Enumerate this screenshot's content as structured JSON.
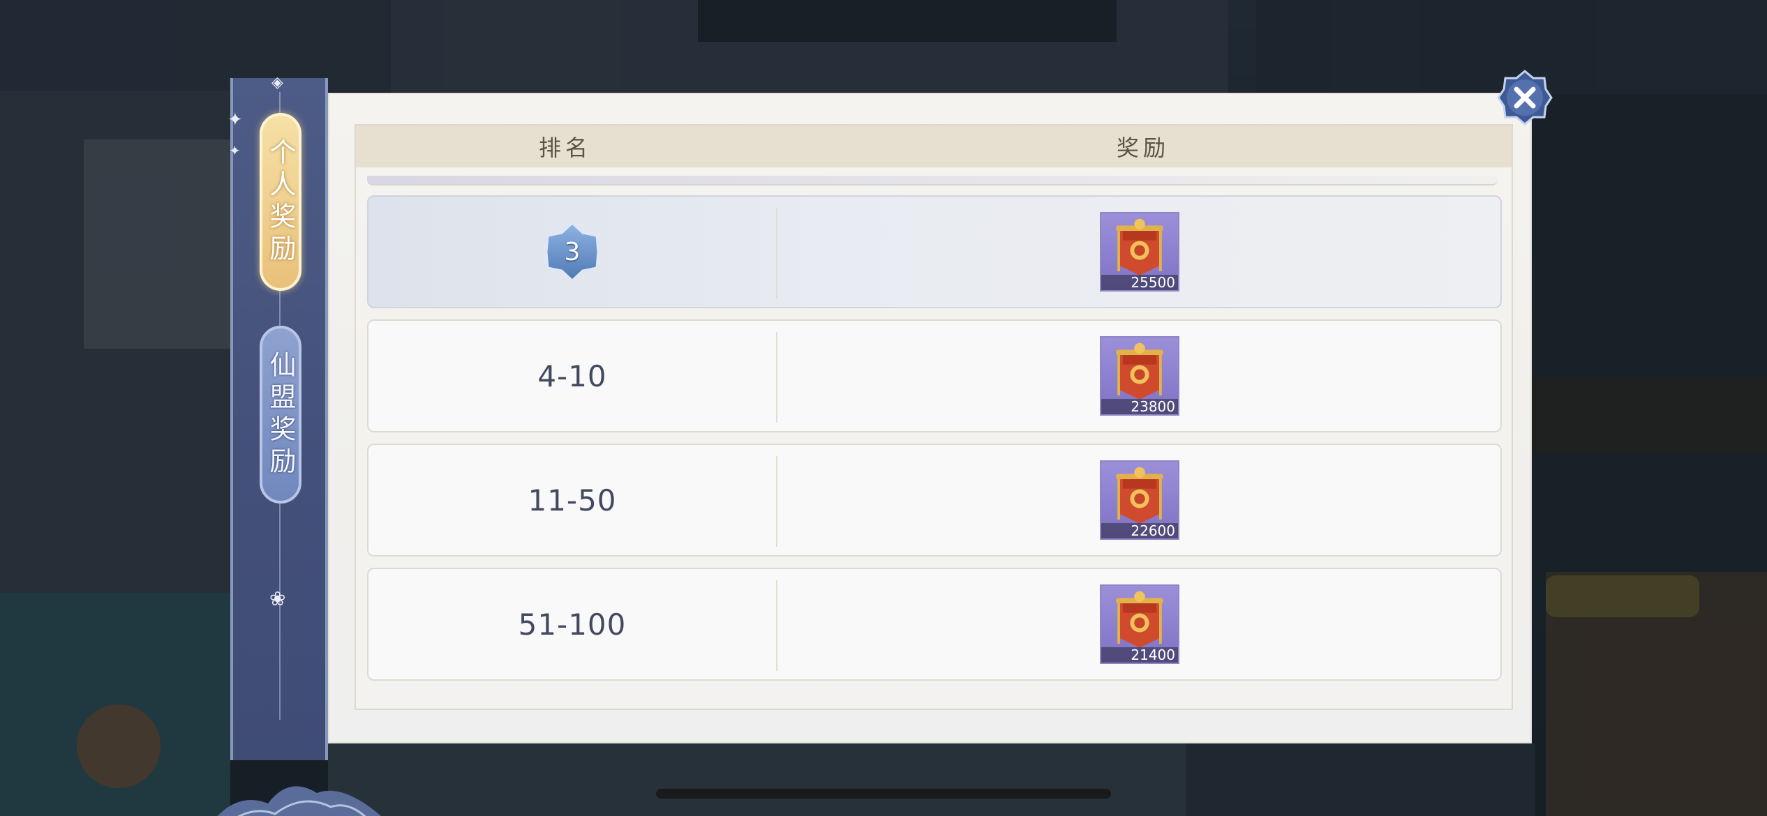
{
  "tabs": [
    {
      "label": "个人奖励",
      "selected": true
    },
    {
      "label": "仙盟奖励",
      "selected": false
    }
  ],
  "table": {
    "headers": {
      "rank": "排名",
      "reward": "奖励"
    },
    "rows": [
      {
        "rank": "3",
        "rank_style": "badge",
        "reward_icon": "banner-icon",
        "reward_count": "25500"
      },
      {
        "rank": "4-10",
        "rank_style": "text",
        "reward_icon": "banner-icon",
        "reward_count": "23800"
      },
      {
        "rank": "11-50",
        "rank_style": "text",
        "reward_icon": "banner-icon",
        "reward_count": "22600"
      },
      {
        "rank": "51-100",
        "rank_style": "text",
        "reward_icon": "banner-icon",
        "reward_count": "21400"
      }
    ]
  },
  "colors": {
    "tab_selected": "#e8c17a",
    "tab_unselected": "#7188bd",
    "header_bg": "#e7dfd0",
    "item_frame": "#8f86c4"
  }
}
